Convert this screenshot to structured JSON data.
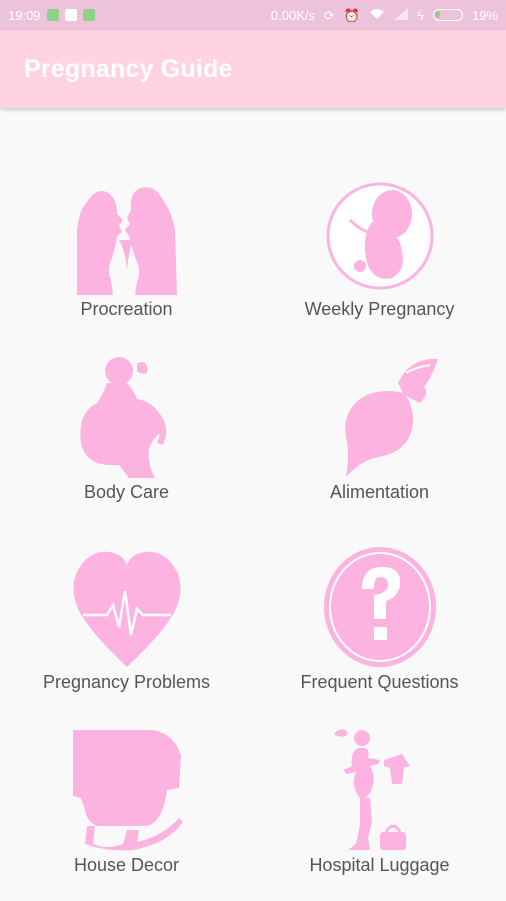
{
  "status_bar": {
    "time": "19:09",
    "network_speed": "0.00K/s",
    "battery_percent": "19%",
    "icons": [
      "app-notification-icon",
      "play-store-icon",
      "app-notification-icon",
      "sync-icon",
      "alarm-icon",
      "wifi-icon",
      "signal-icon",
      "charging-icon",
      "battery-icon"
    ]
  },
  "app_bar": {
    "title": "Pregnancy Guide"
  },
  "menu": {
    "items": [
      {
        "label": "Procreation",
        "icon": "couple-kissing-icon"
      },
      {
        "label": "Weekly Pregnancy",
        "icon": "fetus-icon"
      },
      {
        "label": "Body Care",
        "icon": "pregnant-woman-icon"
      },
      {
        "label": "Alimentation",
        "icon": "beetroot-icon"
      },
      {
        "label": "Pregnancy Problems",
        "icon": "heartbeat-heart-icon"
      },
      {
        "label": "Frequent Questions",
        "icon": "question-mark-icon"
      },
      {
        "label": "House Decor",
        "icon": "cradle-icon"
      },
      {
        "label": "Hospital Luggage",
        "icon": "mother-with-luggage-icon"
      }
    ]
  },
  "colors": {
    "status_bar": "#edc3dc",
    "app_bar": "#ffd3e0",
    "icon_pink": "#fdb3e0",
    "label_text": "#555555"
  }
}
